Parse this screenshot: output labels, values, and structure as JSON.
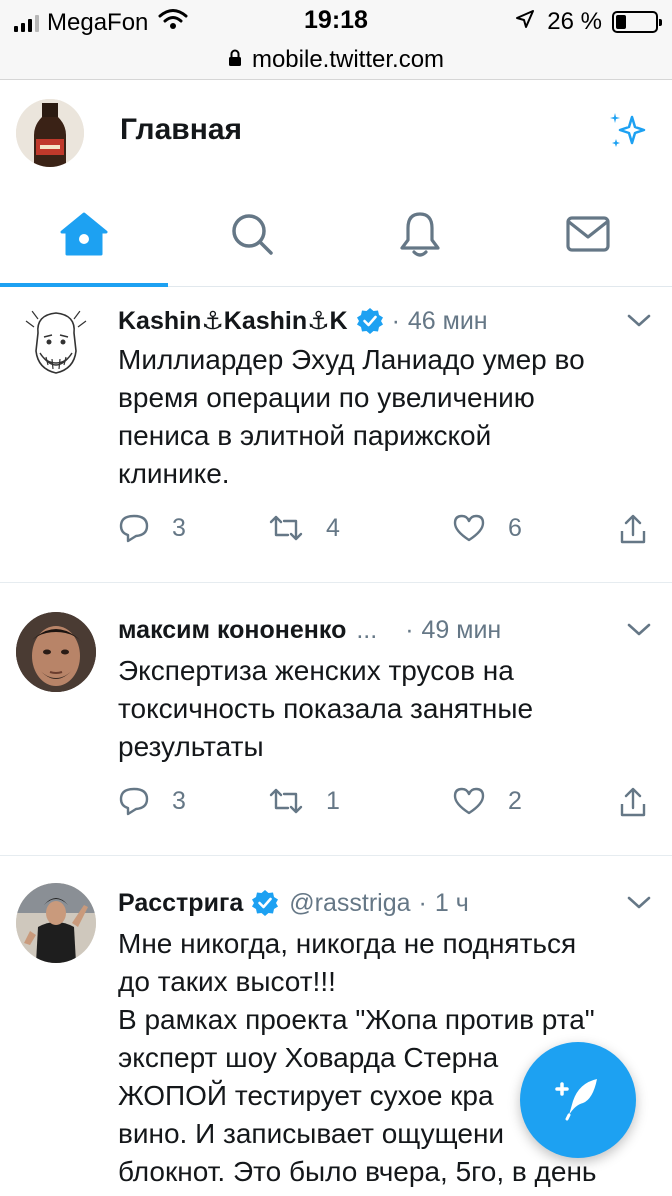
{
  "status_bar": {
    "carrier": "MegaFon",
    "time": "19:18",
    "battery": "26 %",
    "battery_level": 0.26
  },
  "url_bar": {
    "url": "mobile.twitter.com"
  },
  "header": {
    "title": "Главная"
  },
  "tabs": [
    "home-icon",
    "search-icon",
    "bell-icon",
    "mail-icon"
  ],
  "colors": {
    "accent": "#1da1f2",
    "secondary_text": "#657786",
    "primary_text": "#14171a"
  },
  "tweets": [
    {
      "name": "Kashin⚓Kashin⚓K",
      "verified": true,
      "handle": "",
      "sep": "·",
      "time": "46 мин",
      "text": "Миллиардер Эхуд Ланиадо умер во\nвремя операции по увеличению\nпениса в элитной парижской\nклинике.",
      "replies": "3",
      "retweets": "4",
      "likes": "6"
    },
    {
      "name": "максим кононенко",
      "verified": false,
      "handle": "...",
      "sep": "·",
      "time": "49 мин",
      "text": "Экспертиза женских трусов на\nтоксичность показала занятные\nрезультаты",
      "replies": "3",
      "retweets": "1",
      "likes": "2"
    },
    {
      "name": "Расстрига",
      "verified": true,
      "handle": "@rasstriga",
      "sep": "·",
      "time": "1 ч",
      "text": "Мне никогда, никогда не подняться\nдо таких высот!!!\n В рамках проекта \"Жопа против рта\"\nэксперт шоу Ховарда Стерна\nЖОПОЙ тестирует сухое кра\nвино. И записывает ощущени\nблокнот. Это было вчера, 5го, в день"
    }
  ]
}
